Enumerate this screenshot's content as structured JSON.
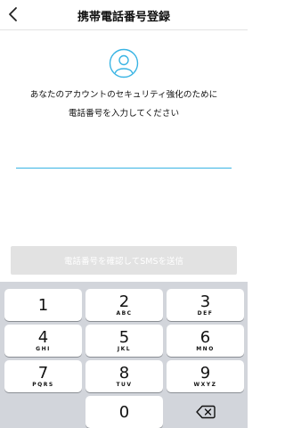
{
  "header": {
    "title": "携帯電話番号登録"
  },
  "message": {
    "line1": "あなたのアカウントのセキュリティ強化のために",
    "line2": "電話番号を入力してください"
  },
  "phone_input": {
    "value": "",
    "placeholder": ""
  },
  "submit": {
    "label": "電話番号を確認してSMSを送信"
  },
  "keypad": {
    "keys": [
      {
        "num": "1",
        "letters": ""
      },
      {
        "num": "2",
        "letters": "ABC"
      },
      {
        "num": "3",
        "letters": "DEF"
      },
      {
        "num": "4",
        "letters": "GHI"
      },
      {
        "num": "5",
        "letters": "JKL"
      },
      {
        "num": "6",
        "letters": "MNO"
      },
      {
        "num": "7",
        "letters": "PQRS"
      },
      {
        "num": "8",
        "letters": "TUV"
      },
      {
        "num": "9",
        "letters": "WXYZ"
      },
      {
        "num": "0",
        "letters": ""
      }
    ]
  },
  "colors": {
    "accent": "#39b4e4",
    "button_disabled": "#e2e2e2",
    "keypad_bg": "#d2d5db"
  }
}
